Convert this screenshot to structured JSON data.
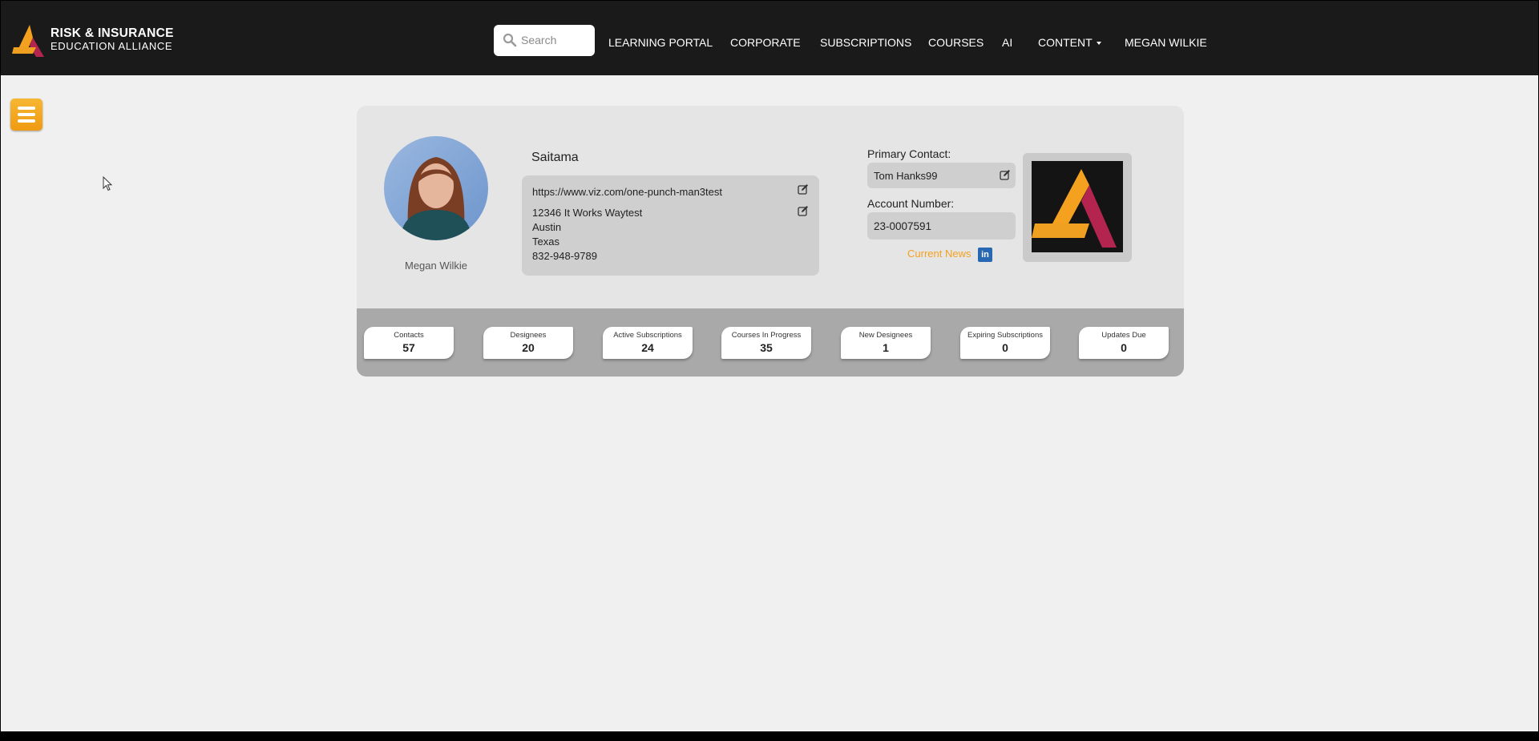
{
  "brand": {
    "line1": "RISK & INSURANCE",
    "line2": "EDUCATION ALLIANCE"
  },
  "search": {
    "placeholder": "Search"
  },
  "nav": {
    "learning_portal": "LEARNING PORTAL",
    "corporate": "CORPORATE",
    "subscriptions": "SUBSCRIPTIONS",
    "courses": "COURSES",
    "ai": "AI",
    "content": "CONTENT",
    "user": "MEGAN WILKIE"
  },
  "profile": {
    "person_name": "Megan Wilkie",
    "company_name": "Saitama",
    "website": "https://www.viz.com/one-punch-man3test",
    "address_street": "12346 It Works Waytest",
    "address_city": "Austin",
    "address_state": "Texas",
    "phone": "832-948-9789",
    "primary_contact_label": "Primary Contact:",
    "primary_contact": "Tom Hanks99",
    "account_number_label": "Account Number:",
    "account_number": "23-0007591",
    "news_link": "Current News",
    "linkedin_icon": "in"
  },
  "stats": [
    {
      "label": "Contacts",
      "value": "57"
    },
    {
      "label": "Designees",
      "value": "20"
    },
    {
      "label": "Active Subscriptions",
      "value": "24"
    },
    {
      "label": "Courses In Progress",
      "value": "35"
    },
    {
      "label": "New Designees",
      "value": "1"
    },
    {
      "label": "Expiring Subscriptions",
      "value": "0"
    },
    {
      "label": "Updates Due",
      "value": "0"
    }
  ],
  "colors": {
    "nav_bg": "#1a1a1a",
    "accent_orange": "#f4a11f",
    "accent_crimson": "#b3244e",
    "card_bg": "#e5e5e5",
    "stats_bar": "#a9a9a9"
  }
}
